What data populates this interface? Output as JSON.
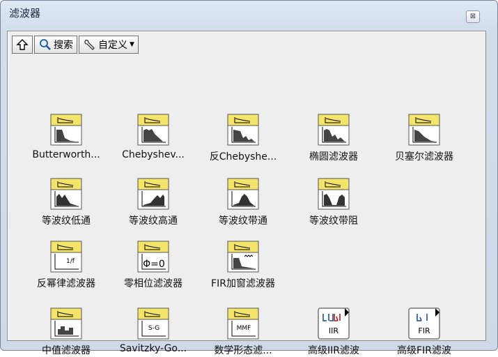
{
  "window": {
    "title": "滤波器",
    "close_label": "⊠"
  },
  "toolbar": {
    "search_label": "搜索",
    "custom_label": "自定义"
  },
  "palette": {
    "rows": [
      [
        {
          "label": "Butterworth...",
          "icon": "butterworth-filter-icon"
        },
        {
          "label": "Chebyshev...",
          "icon": "chebyshev-filter-icon"
        },
        {
          "label": "反Chebyshe...",
          "icon": "inverse-chebyshev-filter-icon"
        },
        {
          "label": "椭圆滤波器",
          "icon": "elliptic-filter-icon"
        },
        {
          "label": "贝塞尔滤波器",
          "icon": "bessel-filter-icon"
        }
      ],
      [
        {
          "label": "等波纹低通",
          "icon": "equiripple-lowpass-icon"
        },
        {
          "label": "等波纹高通",
          "icon": "equiripple-highpass-icon"
        },
        {
          "label": "等波纹带通",
          "icon": "equiripple-bandpass-icon"
        },
        {
          "label": "等波纹带阻",
          "icon": "equiripple-bandstop-icon"
        }
      ],
      [
        {
          "label": "反幂律滤波器",
          "icon": "inverse-power-law-filter-icon",
          "text": "1/f"
        },
        {
          "label": "零相位滤波器",
          "icon": "zero-phase-filter-icon",
          "text": "Φ=0"
        },
        {
          "label": "FIR加窗滤波器",
          "icon": "fir-windowed-filter-icon"
        }
      ],
      [
        {
          "label": "中值滤波器",
          "icon": "median-filter-icon"
        },
        {
          "label": "Savitzky-Go...",
          "icon": "savitzky-golay-filter-icon",
          "text": "S-G"
        },
        {
          "label": "数学形态滤...",
          "icon": "morphological-filter-icon",
          "text": "MMF"
        },
        {
          "label": "高级IIR滤波",
          "icon": "advanced-iir-subpalette-icon",
          "text": "IIR"
        },
        {
          "label": "高级FIR滤波",
          "icon": "advanced-fir-subpalette-icon",
          "text": "FIR"
        }
      ]
    ]
  }
}
